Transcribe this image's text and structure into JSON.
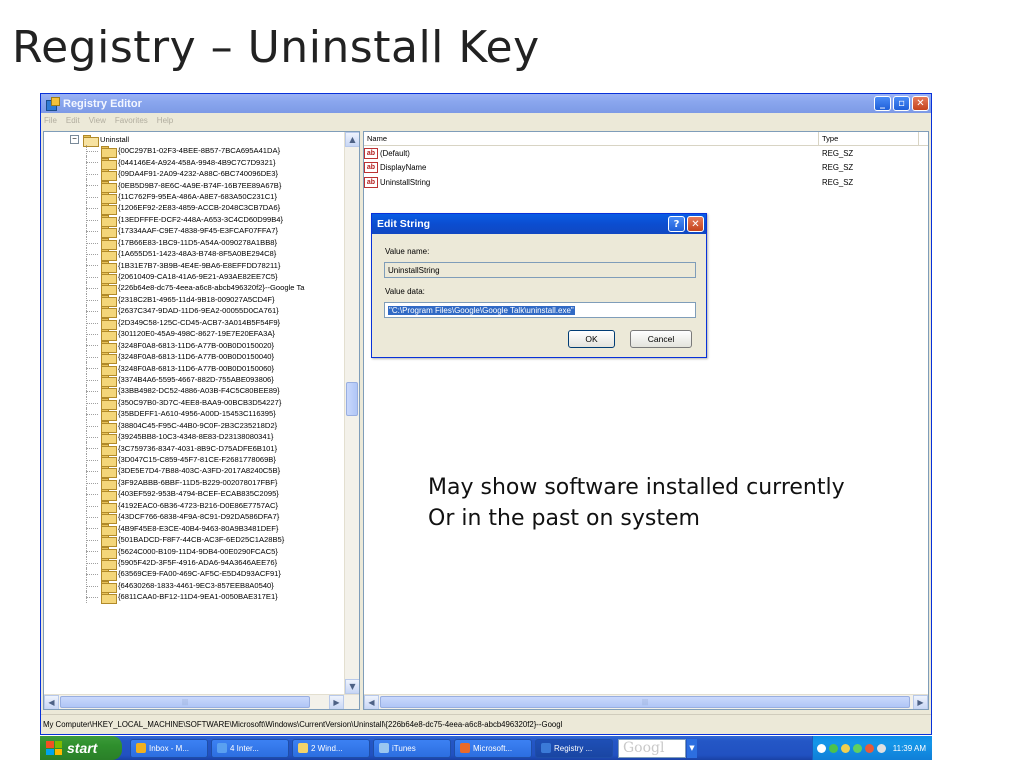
{
  "slide": {
    "title": "Registry – Uninstall Key",
    "annotation_line1": "May show software installed currently",
    "annotation_line2": "Or in the past on system"
  },
  "window": {
    "title": "Registry Editor",
    "menu": [
      "File",
      "Edit",
      "View",
      "Favorites",
      "Help"
    ],
    "minimize": "_",
    "maximize": "▫",
    "close": "✕"
  },
  "tree": {
    "root_expander": "−",
    "root_label": "Uninstall",
    "items": [
      "{00C297B1-02F3-4BEE-8B57-7BCA695A41DA}",
      "{044146E4-A924-458A-9948-4B9C7C7D9321}",
      "{09DA4F91-2A09-4232-A88C-6BC740096DE3}",
      "{0EB5D9B7-8E6C-4A9E-B74F-16B7EE89A67B}",
      "{11C762F9-95EA-486A-A8E7-683A50C231C1}",
      "{1206EF92-2E83-4859-ACCB-2048C3CB7DA6}",
      "{13EDFFFE-DCF2-448A-A653-3C4CD60D99B4}",
      "{17334AAF-C9E7-4838-9F45-E3FCAF07FFA7}",
      "{17B66E83-1BC9-11D5-A54A-0090278A1BB8}",
      "{1A655D51-1423-48A3-B748-8F5A0BE294C8}",
      "{1B31E7B7-3B9B-4E4E-9BA6-E8EFFDD78211}",
      "{20610409-CA18-41A6-9E21-A93AE82EE7C5}",
      "{226b64e8-dc75-4eea-a6c8-abcb496320f2}--Google Ta",
      "{2318C2B1-4965-11d4-9B18-009027A5CD4F}",
      "{2637C347-9DAD-11D6-9EA2-00055D0CA761}",
      "{2D349C58-125C-CD45-ACB7-3A014B5F54F9}",
      "{301120E0-45A9-498C-8627-19E7E20EFA3A}",
      "{3248F0A8-6813-11D6-A77B-00B0D0150020}",
      "{3248F0A8-6813-11D6-A77B-00B0D0150040}",
      "{3248F0A8-6813-11D6-A77B-00B0D0150060}",
      "{3374B4A6-5595-4667-882D-755ABE093806}",
      "{33BB4982-DC52-4886-A03B-F4C5C80BEE89}",
      "{350C97B0-3D7C-4EE8-BAA9-00BCB3D54227}",
      "{35BDEFF1-A610-4956-A00D-15453C116395}",
      "{38804C45-F95C-44B0-9C0F-2B3C235218D2}",
      "{39245BB8-10C3-4348-8E83-D23138080341}",
      "{3C759736-8347-4031-8B9C-D75ADFE6B101}",
      "{3D047C15-C859-45F7-81CE-F2681778069B}",
      "{3DE5E7D4-7B88-403C-A3FD-2017A8240C5B}",
      "{3F92ABBB-6BBF-11D5-B229-002078017FBF}",
      "{403EF592-953B-4794-BCEF-ECAB835C2095}",
      "{4192EAC0-6B36-4723-B216-D0E86E7757AC}",
      "{43DCF766-6838-4F9A-8C91-D92DA586DFA7}",
      "{4B9F45E8-E3CE-40B4-9463-80A9B3481DEF}",
      "{501BADCD-F8F7-44CB-AC3F-6ED25C1A28B5}",
      "{5624C000-B109-11D4-9DB4-00E0290FCAC5}",
      "{5905F42D-3F5F-4916-ADA6-94A3646AEE76}",
      "{63569CE9-FA00-469C-AF5C-E5D4D93ACF91}",
      "{64630268-1833-4461-9EC3-857EEB8A0540}",
      "{6811CAA0-BF12-11D4-9EA1-0050BAE317E1}"
    ]
  },
  "list": {
    "header_name": "Name",
    "header_type": "Type",
    "rows": [
      {
        "icon": "ab",
        "name": "(Default)",
        "type": "REG_SZ"
      },
      {
        "icon": "ab",
        "name": "DisplayName",
        "type": "REG_SZ"
      },
      {
        "icon": "ab",
        "name": "UninstallString",
        "type": "REG_SZ"
      }
    ]
  },
  "dialog": {
    "title": "Edit String",
    "help": "?",
    "close": "✕",
    "value_name_label": "Value name:",
    "value_name": "UninstallString",
    "value_data_label": "Value data:",
    "value_data": "\"C:\\Program Files\\Google\\Google Talk\\uninstall.exe\"",
    "ok_label": "OK",
    "cancel_label": "Cancel"
  },
  "statusbar": {
    "path": "My Computer\\HKEY_LOCAL_MACHINE\\SOFTWARE\\Microsoft\\Windows\\CurrentVersion\\Uninstall\\{226b64e8-dc75-4eea-a6c8-abcb496320f2}--Googl"
  },
  "taskbar": {
    "start_label": "start",
    "items": [
      {
        "label": "Inbox - M...",
        "icon_color": "#f0b020"
      },
      {
        "label": "4 Inter...",
        "icon_color": "#5aa0f0"
      },
      {
        "label": "2 Wind...",
        "icon_color": "#f3d36a"
      },
      {
        "label": "iTunes",
        "icon_color": "#9ac7f0"
      },
      {
        "label": "Microsoft...",
        "icon_color": "#e86a2a"
      },
      {
        "label": "Registry ...",
        "icon_color": "#3b7ad8"
      }
    ],
    "google_label": "Googl",
    "clock": "11:39 AM"
  },
  "colors": {
    "xp_blue": "#2457c6",
    "start_green": "#2f8f2d",
    "selection_blue": "#316ac5"
  }
}
